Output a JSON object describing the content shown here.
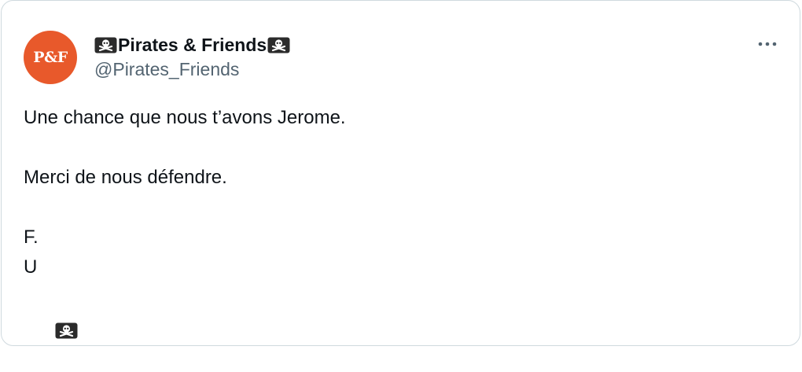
{
  "author": {
    "avatar_text": "P&F",
    "display_name": "Pirates & Friends",
    "handle": "@Pirates_Friends",
    "name_emoji": "pirate-flag-icon",
    "avatar_color": "#e8592b"
  },
  "menu": {
    "icon": "more-dots-icon"
  },
  "tweet": {
    "line1": "Une chance que nous t’avons Jerome.",
    "line2": "Merci de nous défendre.",
    "line3": "F.",
    "line4": "U",
    "end_emoji": "pirate-flag-icon"
  }
}
